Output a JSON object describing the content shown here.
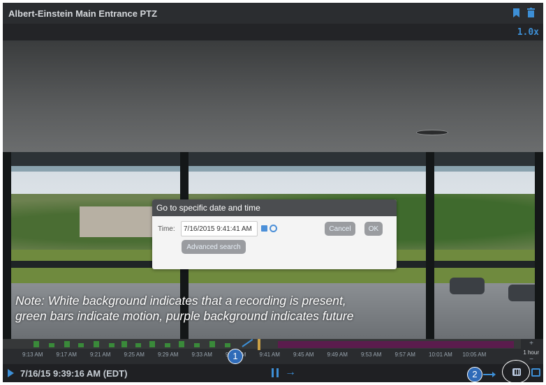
{
  "header": {
    "title": "Albert-Einstein Main Entrance PTZ",
    "zoom": "1.0x"
  },
  "dialog": {
    "title": "Go to specific date and time",
    "time_label": "Time:",
    "time_value": "7/16/2015 9:41:41 AM",
    "cancel_label": "Cancel",
    "ok_label": "OK",
    "advanced_label": "Advanced search"
  },
  "note": {
    "line1": "Note: White background indicates that a recording is present,",
    "line2": "green bars indicate motion, purple background indicates future"
  },
  "timeline": {
    "ticks": [
      "9:13 AM",
      "9:17 AM",
      "9:21 AM",
      "9:25 AM",
      "9:29 AM",
      "9:33 AM",
      "9:37 AM",
      "9:41 AM",
      "9:45 AM",
      "9:49 AM",
      "9:53 AM",
      "9:57 AM",
      "10:01 AM",
      "10:05 AM"
    ],
    "plus": "+",
    "scale": "1 hour",
    "minus": "−"
  },
  "bottom": {
    "current_time": "7/16/15 9:39:16 AM (EDT)"
  },
  "callouts": {
    "c1": "1",
    "c2": "2"
  },
  "colors": {
    "accent": "#3d8fd6",
    "motion": "#3a8a3a",
    "future": "#5b1c4d"
  },
  "icons": [
    "bookmark-icon",
    "trash-icon",
    "calendar-icon",
    "clock-icon",
    "play-icon",
    "pause-icon",
    "forward-icon",
    "goto-date-icon",
    "snapshot-icon"
  ]
}
